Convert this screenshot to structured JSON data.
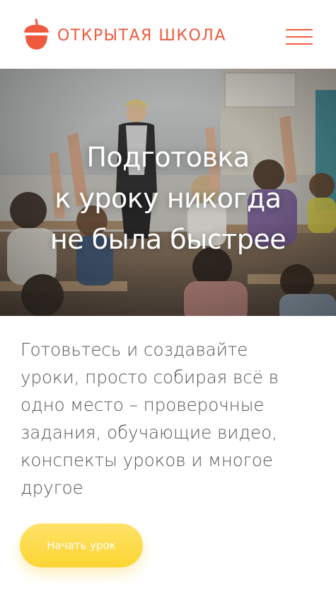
{
  "header": {
    "logo_text": "ОТКРЫТАЯ ШКОЛА",
    "logo_icon": "acorn-icon",
    "menu_icon": "hamburger-menu-icon"
  },
  "hero": {
    "title_lines": [
      "Подготовка",
      "к уроку никогда",
      "не была быстрее"
    ]
  },
  "description": {
    "lines": [
      "Готовьтесь и создавайте",
      "уроки, просто собирая всё в",
      "одно место – проверочные",
      "задания, обучающие видео,",
      "конспекты уроков и многое",
      "другое"
    ]
  },
  "cta": {
    "label": "Начать урок"
  },
  "colors": {
    "brand": "#ef5a3d",
    "cta": "#fcd533",
    "text": "#555555"
  }
}
